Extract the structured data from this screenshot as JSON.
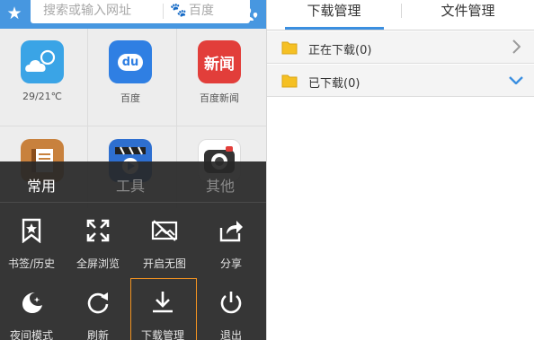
{
  "home": {
    "search": {
      "placeholder": "搜索或输入网址",
      "engine_label": "百度"
    },
    "apps": [
      {
        "label": "29/21℃",
        "icon": "weather-icon"
      },
      {
        "label": "百度",
        "icon": "baidu-icon",
        "glyph": "du"
      },
      {
        "label": "百度新闻",
        "icon": "news-icon",
        "glyph": "新闻"
      },
      {
        "label": "",
        "icon": "book-icon"
      },
      {
        "label": "",
        "icon": "video-icon"
      },
      {
        "label": "",
        "icon": "camera-icon"
      }
    ]
  },
  "menu": {
    "tabs": [
      {
        "label": "常用",
        "active": true
      },
      {
        "label": "工具",
        "active": false
      },
      {
        "label": "其他",
        "active": false
      }
    ],
    "items": [
      {
        "label": "书签/历史",
        "icon": "bookmark-icon"
      },
      {
        "label": "全屏浏览",
        "icon": "fullscreen-icon"
      },
      {
        "label": "开启无图",
        "icon": "no-image-icon"
      },
      {
        "label": "分享",
        "icon": "share-icon"
      },
      {
        "label": "夜间模式",
        "icon": "night-mode-icon"
      },
      {
        "label": "刷新",
        "icon": "refresh-icon"
      },
      {
        "label": "下载管理",
        "icon": "download-icon",
        "selected": true
      },
      {
        "label": "退出",
        "icon": "power-icon"
      }
    ]
  },
  "download_manager": {
    "tabs": [
      {
        "label": "下载管理",
        "active": true
      },
      {
        "label": "文件管理",
        "active": false
      }
    ],
    "folders": [
      {
        "label": "正在下载(0)",
        "arrow": "chevron-right-icon"
      },
      {
        "label": "已下载(0)",
        "arrow": "chevron-down-icon"
      }
    ]
  },
  "colors": {
    "topbar": "#4797e0",
    "accent_blue": "#3b8fe0",
    "menu_highlight": "#f39321",
    "folder": "#f5c023"
  }
}
